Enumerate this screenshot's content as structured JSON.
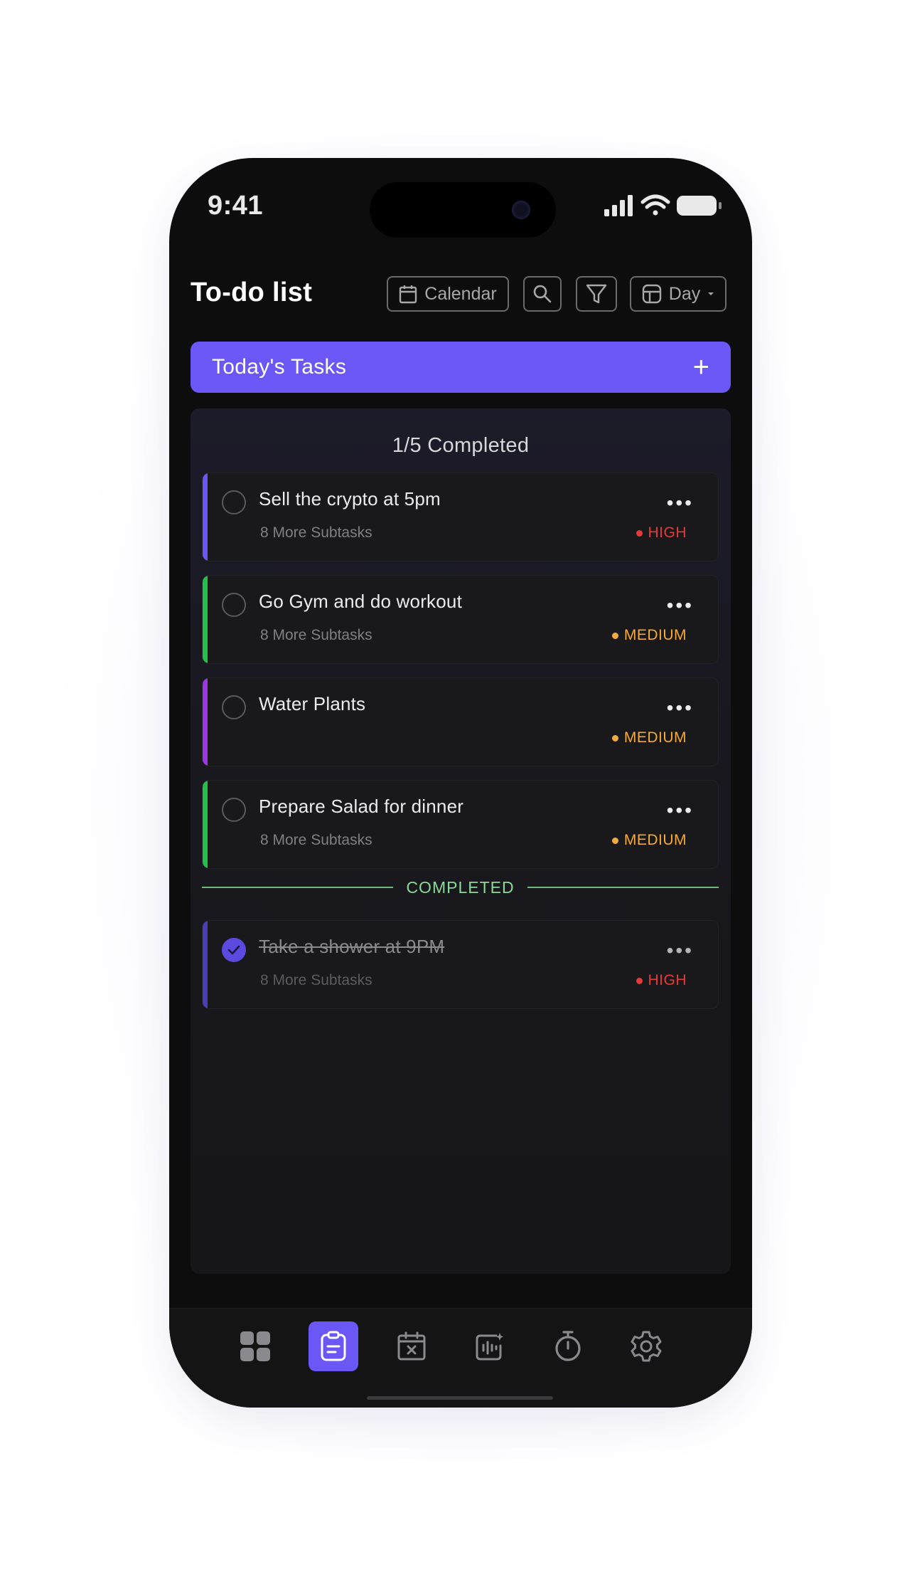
{
  "status_bar": {
    "time": "9:41"
  },
  "header": {
    "title": "To-do list",
    "calendar_label": "Calendar",
    "view_label": "Day"
  },
  "tasks_bar": {
    "title": "Today's Tasks"
  },
  "panel": {
    "progress": "1/5 Completed",
    "tasks": [
      {
        "title": "Sell the crypto at 5pm",
        "subtasks": "8 More Subtasks",
        "priority": "HIGH",
        "strip_color": "#6a57f5",
        "priority_color": "#e5393b"
      },
      {
        "title": "Go Gym and do workout",
        "subtasks": "8 More Subtasks",
        "priority": "MEDIUM",
        "strip_color": "#22c14a",
        "priority_color": "#f4a93b"
      },
      {
        "title": "Water Plants",
        "subtasks": "",
        "priority": "MEDIUM",
        "strip_color": "#9b35e8",
        "priority_color": "#f4a93b"
      },
      {
        "title": "Prepare Salad for dinner",
        "subtasks": "8 More Subtasks",
        "priority": "MEDIUM",
        "strip_color": "#22c14a",
        "priority_color": "#f4a93b"
      }
    ],
    "completed_label": "COMPLETED",
    "completed_tasks": [
      {
        "title": "Take a shower at 9PM",
        "subtasks": "8 More Subtasks",
        "priority": "HIGH",
        "strip_color": "#4a3db8",
        "priority_color": "#e5393b"
      }
    ]
  },
  "tab_bar": {
    "tabs": [
      {
        "icon": "grid-icon",
        "active": false
      },
      {
        "icon": "clipboard-icon",
        "active": true
      },
      {
        "icon": "calendar-x-icon",
        "active": false
      },
      {
        "icon": "voice-ai-icon",
        "active": false
      },
      {
        "icon": "stopwatch-icon",
        "active": false
      },
      {
        "icon": "settings-icon",
        "active": false
      }
    ]
  }
}
